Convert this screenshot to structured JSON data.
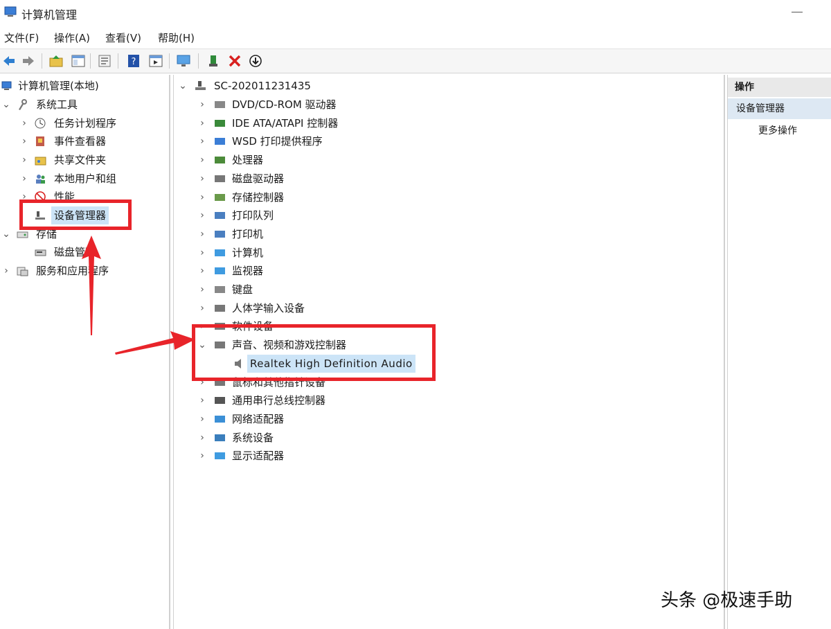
{
  "window": {
    "title": "计算机管理"
  },
  "menu": [
    "文件(F)",
    "操作(A)",
    "查看(V)",
    "帮助(H)"
  ],
  "toolbar": [
    "back-icon",
    "forward-icon",
    "up-folder-icon",
    "show-hide-console-icon",
    "export-icon",
    "help-icon",
    "properties-icon",
    "monitor-icon",
    "update-driver-icon",
    "uninstall-icon",
    "download-icon"
  ],
  "left_tree": {
    "root": "计算机管理(本地)",
    "system_tools": "系统工具",
    "items": [
      "任务计划程序",
      "事件查看器",
      "共享文件夹",
      "本地用户和组",
      "性能",
      "设备管理器"
    ],
    "storage": "存储",
    "disk_mgmt": "磁盘管理",
    "services": "服务和应用程序"
  },
  "device_tree": {
    "computer": "SC-202011231435",
    "categories": [
      "DVD/CD-ROM 驱动器",
      "IDE ATA/ATAPI 控制器",
      "WSD 打印提供程序",
      "处理器",
      "磁盘驱动器",
      "存储控制器",
      "打印队列",
      "打印机",
      "计算机",
      "监视器",
      "键盘",
      "人体学输入设备",
      "软件设备",
      "声音、视频和游戏控制器",
      "鼠标和其他指针设备",
      "通用串行总线控制器",
      "网络适配器",
      "系统设备",
      "显示适配器"
    ],
    "expanded_child": "Realtek High Definition Audio"
  },
  "actions": {
    "header": "操作",
    "selected": "设备管理器",
    "more": "更多操作"
  },
  "watermark": "头条 @极速手助",
  "colors": {
    "highlight": "#e8242a",
    "selection": "#cce4f7"
  }
}
